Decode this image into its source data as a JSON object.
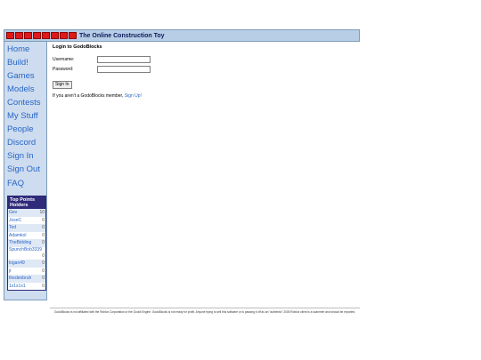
{
  "header": {
    "logo_text": "GODOBLOCKS",
    "tagline": "The Online Construction Toy"
  },
  "sidebar": {
    "items": [
      {
        "label": "Home"
      },
      {
        "label": "Build!"
      },
      {
        "label": "Games"
      },
      {
        "label": "Models"
      },
      {
        "label": "Contests"
      },
      {
        "label": "My Stuff"
      },
      {
        "label": "People"
      },
      {
        "label": "Discord"
      },
      {
        "label": "Sign In"
      },
      {
        "label": "Sign Out"
      },
      {
        "label": "FAQ"
      }
    ]
  },
  "top_points": {
    "title": "Top Points Holders",
    "rows": [
      {
        "name": "Gev",
        "points": "10"
      },
      {
        "name": "JoseC",
        "points": "0"
      },
      {
        "name": "Ted",
        "points": "0"
      },
      {
        "name": "Adamkol",
        "points": "0"
      },
      {
        "name": "TheBidding",
        "points": "0"
      },
      {
        "name": "SpunchBob3339",
        "points": "0"
      },
      {
        "name": "logan49",
        "points": "0"
      },
      {
        "name": "jr",
        "points": "0"
      },
      {
        "name": "thedenbruh",
        "points": "0"
      },
      {
        "name": "1x1x1x1",
        "points": "0"
      }
    ]
  },
  "login": {
    "heading": "Login to GodoBlocks",
    "username_label": "Username:",
    "username_value": "",
    "password_label": "Password:",
    "password_value": "",
    "submit_label": "Sign In",
    "signup_prompt": "If you aren't a GodoBlocks member,",
    "signup_link": "Sign Up!"
  },
  "footer": {
    "disclaimer": "GodoBlocks is not affiliated with the Roblox Corporation or the Godot Engine. GodoBlocks is not ready for profit. Anyone trying to sell this software or is passing it off as an \"authentic\" 2005 Roblox client is a scammer and should be reported."
  },
  "colors": {
    "header_bg": "#b8cde6",
    "sidebar_bg": "#cddcef",
    "link": "#2a66c7",
    "panel_title_bg": "#2f2a7a",
    "logo_red": "#e01818"
  }
}
